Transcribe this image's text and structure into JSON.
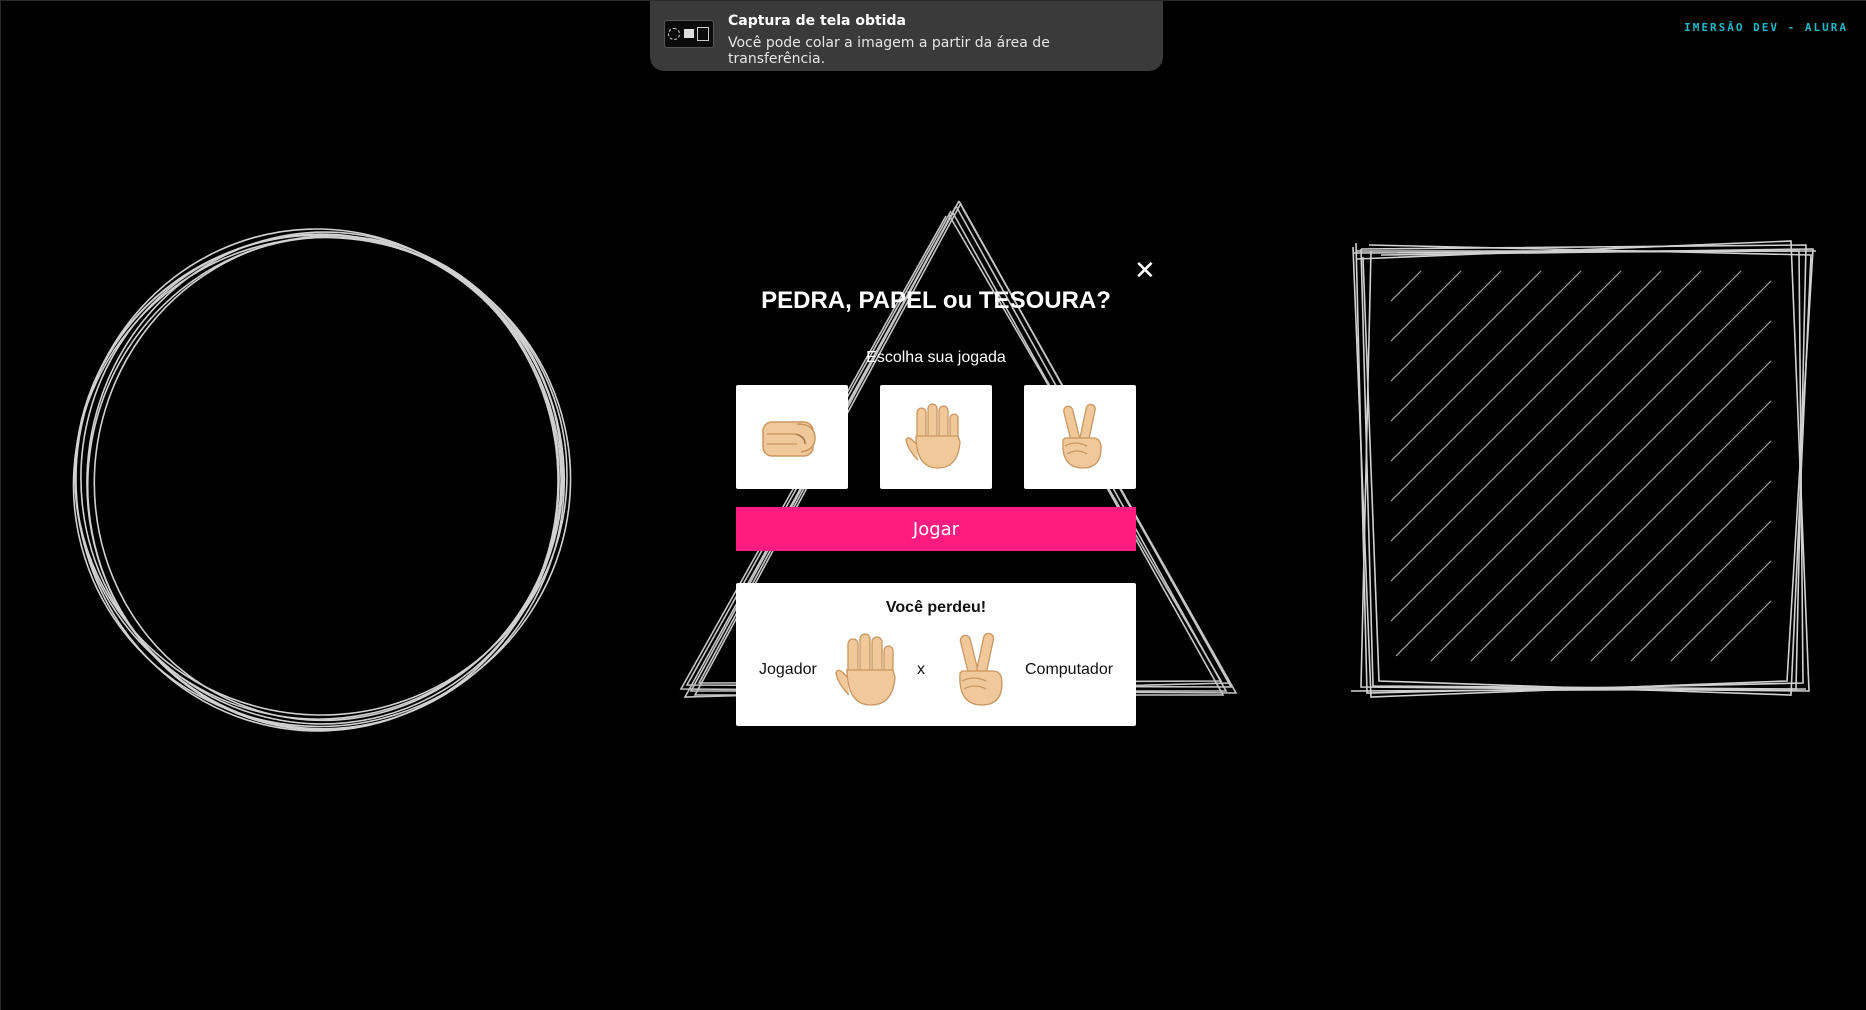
{
  "app": {
    "brand": "IMERSÃO DEV - ALURA"
  },
  "notification": {
    "title": "Captura de tela obtida",
    "body": "Você pode colar a imagem a partir da área de transferência.",
    "icon": "screenshot-thumbnail"
  },
  "game": {
    "title": "PEDRA, PAPEL ou TESOURA?",
    "subtitle": "Escolha sua jogada",
    "close_icon": "close-icon",
    "choices": [
      {
        "id": "rock",
        "icon": "fist-icon"
      },
      {
        "id": "paper",
        "icon": "open-hand-icon"
      },
      {
        "id": "scissors",
        "icon": "victory-hand-icon"
      }
    ],
    "play_label": "Jogar",
    "result": {
      "title": "Você perdeu!",
      "player_label": "Jogador",
      "player_hand": "paper",
      "versus": "x",
      "computer_label": "Computador",
      "computer_hand": "scissors"
    }
  },
  "colors": {
    "background": "#000000",
    "accent": "#ff1b80",
    "brand": "#1fb7c9",
    "skin": "#f0c89a",
    "skin_shadow": "#d9a774"
  }
}
